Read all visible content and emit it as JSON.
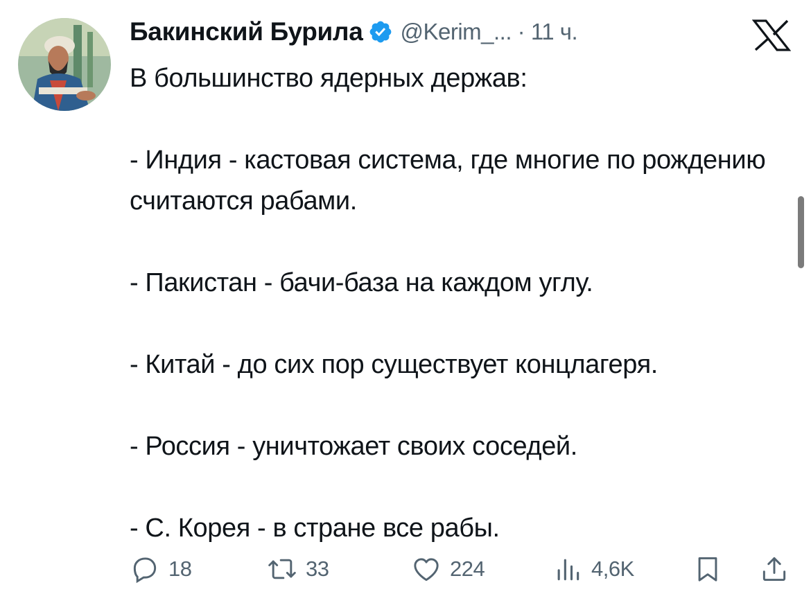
{
  "author": {
    "display_name": "Бакинский Бурила",
    "handle_time": "@Kerim_... · 11 ч.",
    "avatar_icon": "avatar-painting",
    "verified_icon": "verified-badge-icon",
    "verified_color": "#1d9bf0"
  },
  "platform": {
    "logo_icon": "x-logo-icon"
  },
  "tweet": {
    "paragraphs": [
      "В большинство ядерных держав:",
      "- Индия - кастовая система, где многие по рождению считаются рабами.",
      "- Пакистан - бачи-база на каждом углу.",
      "- Китай - до сих пор существует концлагеря.",
      "- Россия - уничтожает своих соседей.",
      "- С. Корея - в стране все рабы."
    ]
  },
  "actions": {
    "reply": {
      "icon": "reply-icon",
      "count": "18"
    },
    "retweet": {
      "icon": "retweet-icon",
      "count": "33"
    },
    "like": {
      "icon": "heart-icon",
      "count": "224"
    },
    "views": {
      "icon": "views-chart-icon",
      "count": "4,6K"
    },
    "bookmark": {
      "icon": "bookmark-icon"
    },
    "share": {
      "icon": "share-icon"
    }
  },
  "colors": {
    "text": "#0f1419",
    "secondary": "#536471",
    "accent": "#1d9bf0"
  }
}
